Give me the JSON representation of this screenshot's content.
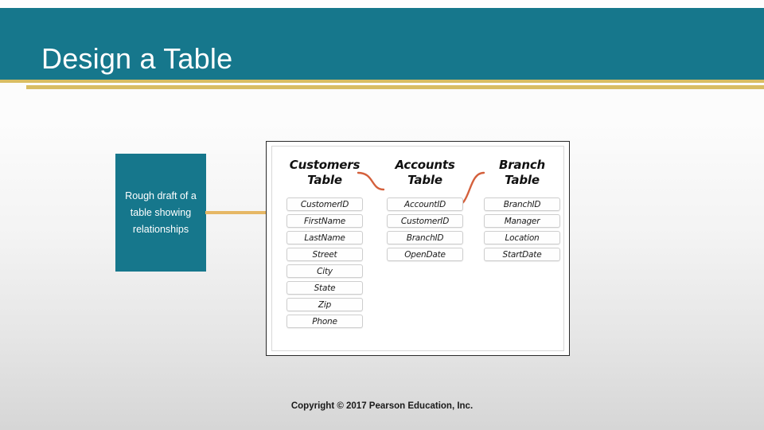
{
  "slide": {
    "title": "Design a Table",
    "accent_teal": "#16778c",
    "accent_gold": "#d9bd63",
    "connector_gold": "#e6b765",
    "relation_orange": "#d4603c"
  },
  "callout": {
    "text": "Rough draft of a table showing relationships"
  },
  "diagram": {
    "tables": [
      {
        "heading_line1": "Customers",
        "heading_line2": "Table",
        "fields": [
          "CustomerID",
          "FirstName",
          "LastName",
          "Street",
          "City",
          "State",
          "Zip",
          "Phone"
        ]
      },
      {
        "heading_line1": "Accounts",
        "heading_line2": "Table",
        "fields": [
          "AccountID",
          "CustomerID",
          "BranchID",
          "OpenDate"
        ]
      },
      {
        "heading_line1": "Branch",
        "heading_line2": "Table",
        "fields": [
          "BranchID",
          "Manager",
          "Location",
          "StartDate"
        ]
      }
    ],
    "relationships": [
      {
        "from": "Customers.CustomerID",
        "to": "Accounts.CustomerID"
      },
      {
        "from": "Accounts.BranchID",
        "to": "Branch.BranchID"
      }
    ]
  },
  "footer": {
    "copyright": "Copyright © 2017 Pearson Education, Inc."
  }
}
